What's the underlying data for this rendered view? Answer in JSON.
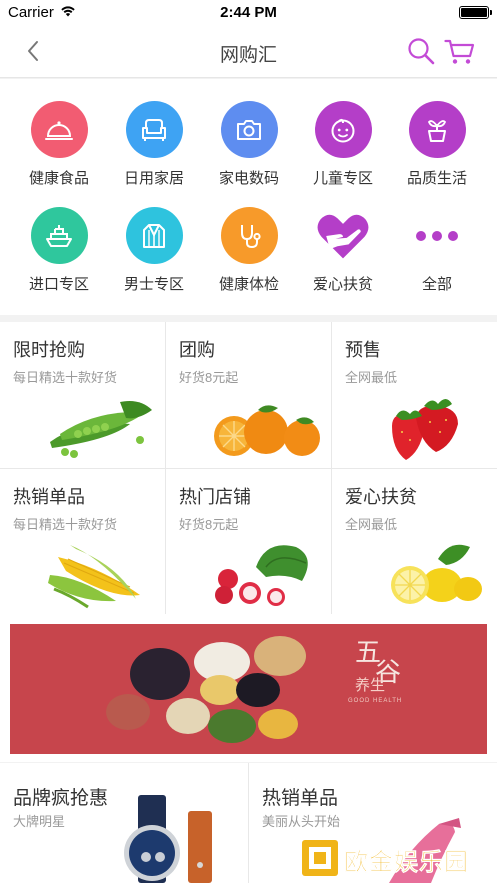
{
  "status_bar": {
    "carrier": "Carrier",
    "time": "2:44 PM"
  },
  "nav": {
    "title": "网购汇"
  },
  "categories": [
    {
      "label": "健康食品",
      "color": "#f25c72",
      "icon": "cloche-icon"
    },
    {
      "label": "日用家居",
      "color": "#3ea3f3",
      "icon": "armchair-icon"
    },
    {
      "label": "家电数码",
      "color": "#5e8df0",
      "icon": "camera-icon"
    },
    {
      "label": "儿童专区",
      "color": "#b43ec8",
      "icon": "baby-face-icon"
    },
    {
      "label": "品质生活",
      "color": "#b43ec8",
      "icon": "potted-plant-icon"
    },
    {
      "label": "进口专区",
      "color": "#2fc79d",
      "icon": "ship-icon"
    },
    {
      "label": "男士专区",
      "color": "#2ec3de",
      "icon": "suit-icon"
    },
    {
      "label": "健康体检",
      "color": "#f79a2a",
      "icon": "stethoscope-icon"
    },
    {
      "label": "爱心扶贫",
      "color": "#b43ec8",
      "icon": "heart-hand-icon"
    },
    {
      "label": "全部",
      "color": "#b43ec8",
      "icon": "more-dots-icon"
    }
  ],
  "products": [
    {
      "title": "限时抢购",
      "subtitle": "每日精选十款好货",
      "image": "peas"
    },
    {
      "title": "团购",
      "subtitle": "好货8元起",
      "image": "oranges"
    },
    {
      "title": "预售",
      "subtitle": "全网最低",
      "image": "strawberries"
    },
    {
      "title": "热销单品",
      "subtitle": "每日精选十款好货",
      "image": "corn"
    },
    {
      "title": "热门店铺",
      "subtitle": "好货8元起",
      "image": "radishes"
    },
    {
      "title": "爱心扶贫",
      "subtitle": "全网最低",
      "image": "lemons"
    }
  ],
  "banner": {
    "title_chars": [
      "五",
      "谷"
    ],
    "subtitle": "养生",
    "english": "GOOD HEALTH",
    "background": "#c7454c"
  },
  "promos": [
    {
      "title": "品牌疯抢惠",
      "subtitle": "大牌明星",
      "image": "watch"
    },
    {
      "title": "热销单品",
      "subtitle": "美丽从头开始",
      "image": "high-heels"
    }
  ],
  "watermark": {
    "text": "欧金娱乐园",
    "color": "#f0b418"
  }
}
